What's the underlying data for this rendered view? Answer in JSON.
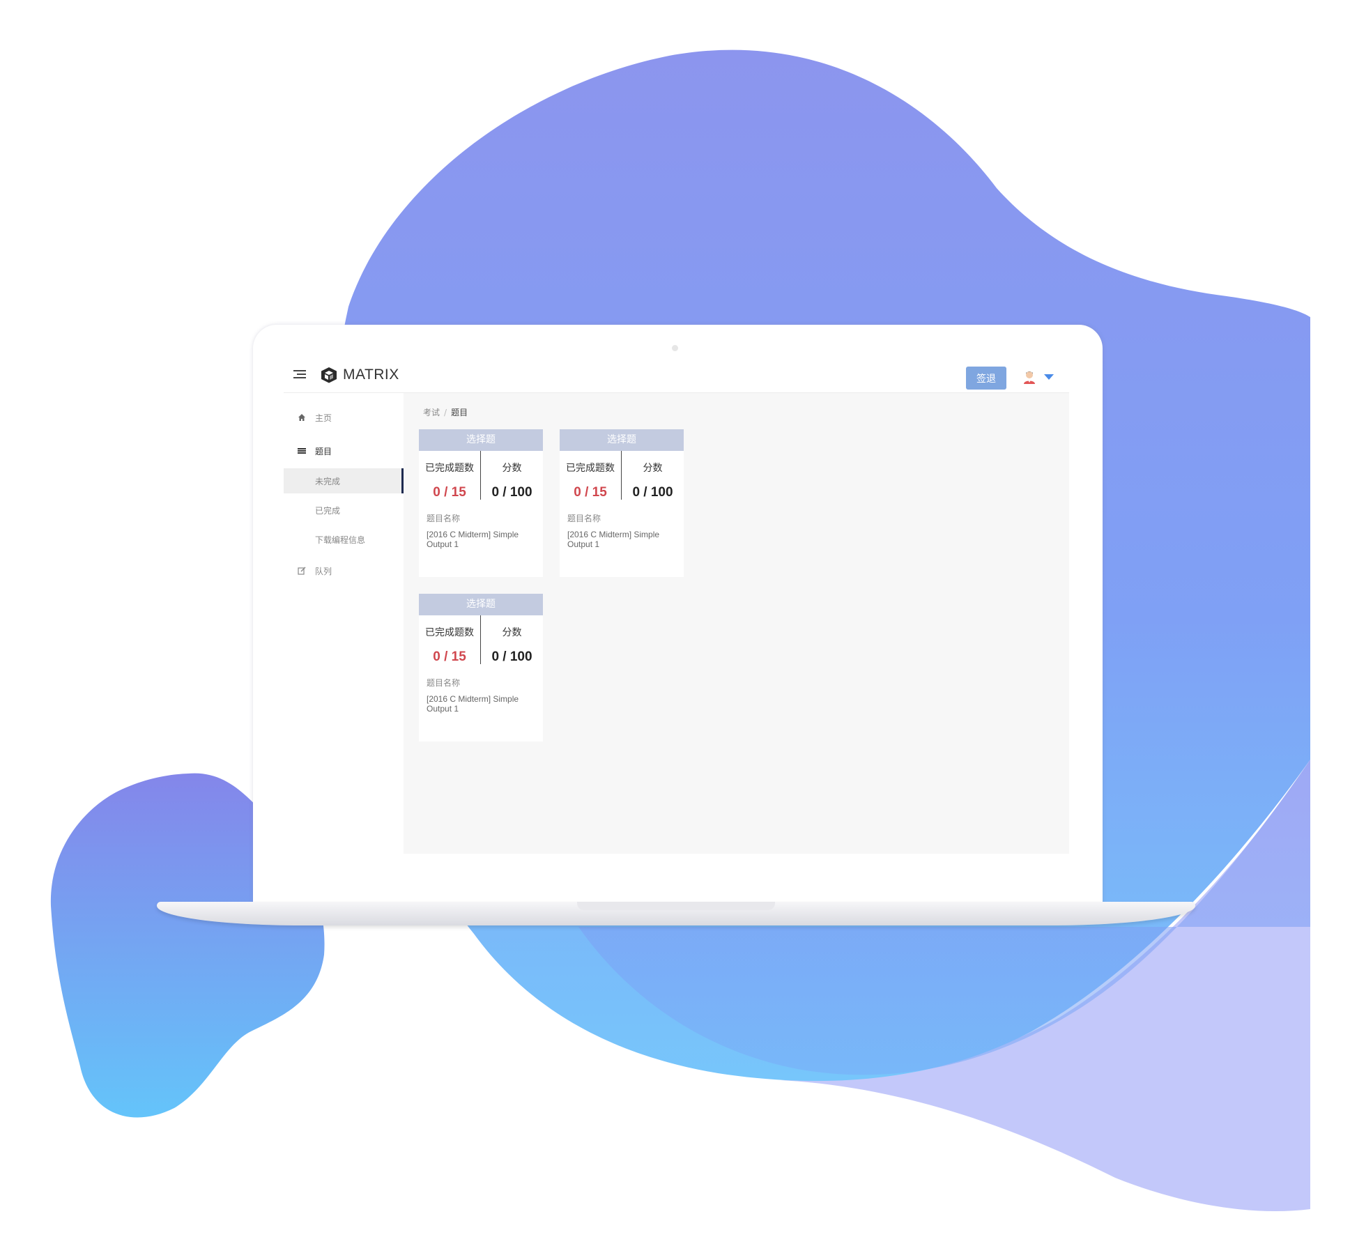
{
  "colors": {
    "blob_top": "#8c96ee",
    "blob_bottom": "#79c1fa",
    "lavender": "#c3c8fa",
    "accent": "#7fa6e0",
    "card_header": "#c3cbe0",
    "progress_red": "#d0474e"
  },
  "header": {
    "menu_icon": "hamburger-icon",
    "logo_icon": "matrix-cube-icon",
    "brand": "MATRIX",
    "signout_label": "签退",
    "avatar_icon": "user-avatar-icon",
    "dropdown_icon": "caret-down-icon"
  },
  "sidebar": {
    "items": [
      {
        "label": "主页",
        "icon": "home-icon"
      },
      {
        "label": "题目",
        "icon": "list-icon"
      },
      {
        "label": "未完成"
      },
      {
        "label": "已完成"
      },
      {
        "label": "下载编程信息"
      },
      {
        "label": "队列",
        "icon": "edit-icon"
      }
    ]
  },
  "breadcrumb": {
    "parent": "考试",
    "separator": "/",
    "current": "题目"
  },
  "cards": [
    {
      "type_label": "选择题",
      "done_label": "已完成题数",
      "done_value": "0 / 15",
      "score_label": "分数",
      "score_value": "0 / 100",
      "name_label": "题目名称",
      "name_value": "[2016 C Midterm] Simple Output 1"
    },
    {
      "type_label": "选择题",
      "done_label": "已完成题数",
      "done_value": "0 / 15",
      "score_label": "分数",
      "score_value": "0 / 100",
      "name_label": "题目名称",
      "name_value": "[2016 C Midterm] Simple Output 1"
    },
    {
      "type_label": "选择题",
      "done_label": "已完成题数",
      "done_value": "0 / 15",
      "score_label": "分数",
      "score_value": "0 / 100",
      "name_label": "题目名称",
      "name_value": "[2016 C Midterm] Simple Output 1"
    }
  ]
}
